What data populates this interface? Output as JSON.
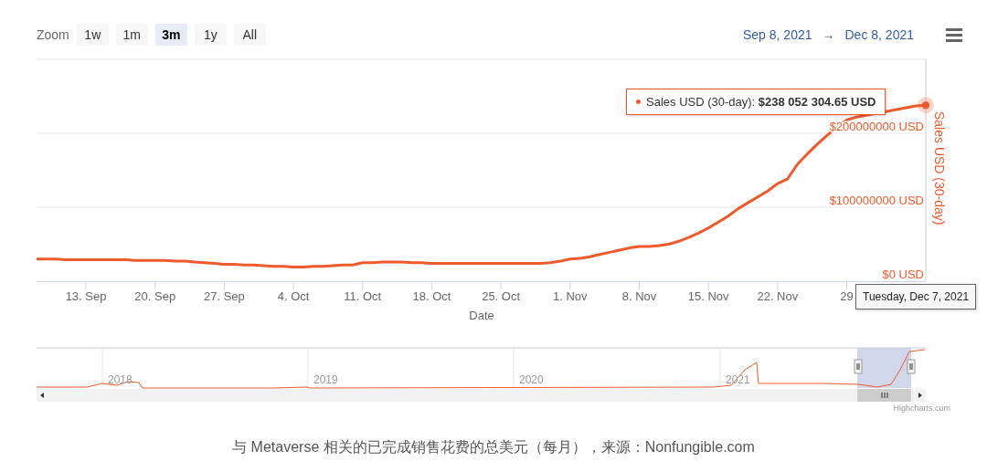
{
  "range_selector": {
    "label": "Zoom",
    "buttons": [
      {
        "label": "1w",
        "selected": false
      },
      {
        "label": "1m",
        "selected": false
      },
      {
        "label": "3m",
        "selected": true
      },
      {
        "label": "1y",
        "selected": false
      },
      {
        "label": "All",
        "selected": false
      }
    ]
  },
  "date_range": {
    "from": "Sep 8, 2021",
    "arrow": "→",
    "to": "Dec 8, 2021"
  },
  "chart": {
    "chart_data": {
      "type": "line",
      "xlabel": "Date",
      "categories": [
        null,
        null,
        null,
        null,
        null,
        "13. Sep",
        null,
        null,
        null,
        null,
        null,
        null,
        "20. Sep",
        null,
        null,
        null,
        null,
        null,
        null,
        "27. Sep",
        null,
        null,
        null,
        null,
        null,
        null,
        "4. Oct",
        null,
        null,
        null,
        null,
        null,
        null,
        "11. Oct",
        null,
        null,
        null,
        null,
        null,
        null,
        "18. Oct",
        null,
        null,
        null,
        null,
        null,
        null,
        "25. Oct",
        null,
        null,
        null,
        null,
        null,
        null,
        "1. Nov",
        null,
        null,
        null,
        null,
        null,
        null,
        "8. Nov",
        null,
        null,
        null,
        null,
        null,
        null,
        "15. Nov",
        null,
        null,
        null,
        null,
        null,
        null,
        "22. Nov",
        null,
        null,
        null,
        null,
        null,
        null,
        "29",
        null,
        null,
        null,
        null,
        null,
        null,
        null,
        null
      ],
      "series": [
        {
          "name": "Sales USD (30-day)",
          "color": "#ee5a2c",
          "values": [
            30000000,
            30000000,
            30000000,
            29000000,
            29000000,
            29000000,
            29000000,
            29000000,
            29000000,
            29000000,
            28000000,
            28000000,
            28000000,
            28000000,
            27000000,
            27000000,
            26000000,
            25000000,
            24000000,
            23000000,
            23000000,
            22000000,
            22000000,
            21000000,
            20000000,
            20000000,
            19000000,
            19000000,
            20000000,
            20000000,
            21000000,
            22000000,
            22000000,
            25000000,
            25000000,
            26000000,
            26000000,
            26000000,
            25000000,
            25000000,
            24000000,
            24000000,
            24000000,
            24000000,
            24000000,
            24000000,
            24000000,
            24000000,
            24000000,
            24000000,
            24000000,
            24000000,
            25000000,
            27000000,
            30000000,
            31000000,
            33000000,
            36000000,
            39000000,
            42000000,
            45000000,
            47000000,
            47000000,
            48000000,
            50000000,
            54000000,
            59000000,
            65000000,
            72000000,
            80000000,
            88000000,
            98000000,
            106000000,
            114000000,
            122000000,
            132000000,
            138000000,
            158000000,
            172000000,
            185000000,
            197000000,
            208000000,
            218000000,
            222000000,
            null,
            null,
            null,
            null,
            null,
            237000000,
            238000000
          ]
        }
      ],
      "ylim": [
        0,
        300000000
      ],
      "yticks": [
        {
          "value": 0,
          "label": "$0 USD"
        },
        {
          "value": 100000000,
          "label": "$100000000 USD"
        },
        {
          "value": 200000000,
          "label": "$200000000 USD"
        }
      ]
    },
    "tooltip": "Sales USD (30-day): **$238 052 304.65 USD**",
    "crosshair_label": "Tuesday, Dec 7, 2021"
  },
  "navigator": {
    "year_labels": [
      "2018",
      "2019",
      "2020",
      "2021"
    ]
  },
  "credits": "Highcharts.com",
  "caption": "与 Metaverse 相关的已完成销售花费的总美元（每月），来源：Nonfungible.com"
}
